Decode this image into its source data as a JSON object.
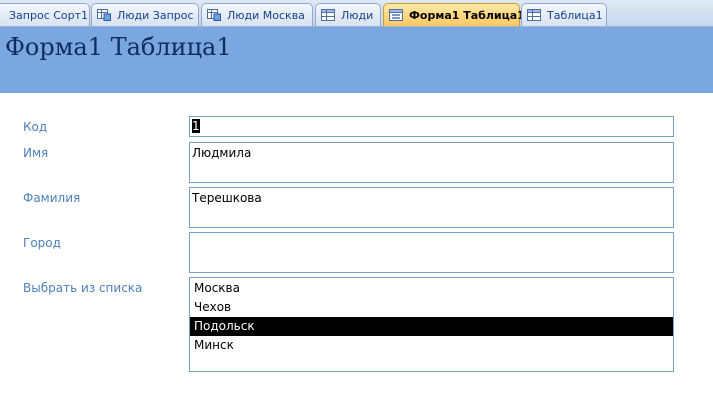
{
  "tabs": [
    {
      "label": "Запрос Сорт1",
      "icon": "query-icon",
      "active": false
    },
    {
      "label": "Люди Запрос",
      "icon": "query-icon",
      "active": false
    },
    {
      "label": "Люди Москва",
      "icon": "query-icon",
      "active": false
    },
    {
      "label": "Люди",
      "icon": "table-icon",
      "active": false
    },
    {
      "label": "Форма1 Таблица1",
      "icon": "form-icon",
      "active": true
    },
    {
      "label": "Таблица1",
      "icon": "table-icon",
      "active": false
    }
  ],
  "form": {
    "title": "Форма1 Таблица1",
    "fields": {
      "kod": {
        "label": "Код",
        "value": "1"
      },
      "imya": {
        "label": "Имя",
        "value": "Людмила"
      },
      "familiya": {
        "label": "Фамилия",
        "value": "Терешкова"
      },
      "gorod": {
        "label": "Город",
        "value": ""
      }
    },
    "list": {
      "label": "Выбрать из списка",
      "options": [
        "Москва",
        "Чехов",
        "Подольск",
        "Минск"
      ],
      "selected": "Подольск"
    }
  },
  "colors": {
    "header_bg": "#7ba7e0",
    "label_text": "#4f81bd",
    "active_tab": "#ffc860"
  }
}
